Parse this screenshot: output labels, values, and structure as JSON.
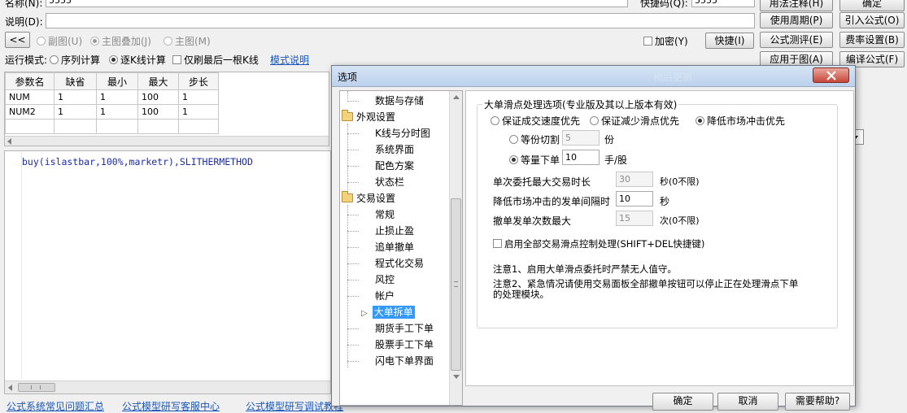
{
  "top": {
    "name_label": "名称(N):",
    "name_value": "5555",
    "shortcut_label": "快捷码(Q):",
    "shortcut_value": "5555",
    "desc_label": "说明(D):",
    "desc_value": "",
    "back_button": "<<",
    "radio_sub_chart": "副图(U)",
    "radio_main_overlay": "主图叠加(J)",
    "radio_main_chart": "主图(M)",
    "encrypt_label": "加密(Y)",
    "quick_button": "快捷(I)",
    "run_mode_label": "运行模式:",
    "run_mode_options": [
      "序列计算",
      "逐K线计算"
    ],
    "refresh_last_label": "仅刷最后一根K线",
    "mode_help_link": "模式说明"
  },
  "right_buttons": {
    "b1": "用法注释(H)",
    "b2": "确定",
    "b3": "使用周期(P)",
    "b4": "引入公式(O)",
    "b5": "公式测评(E)",
    "b6": "费率设置(B)",
    "b7": "应用于图(A)",
    "b8": "编译公式(F)"
  },
  "params": {
    "headers": [
      "参数名",
      "缺省",
      "最小",
      "最大",
      "步长"
    ],
    "rows": [
      [
        "NUM",
        "1",
        "1",
        "100",
        "1"
      ],
      [
        "NUM2",
        "1",
        "1",
        "100",
        "1"
      ]
    ]
  },
  "code": {
    "line": "buy(islastbar,100%,marketr),SLITHERMETHOD"
  },
  "bottom_links": [
    "公式系统常见问题汇总",
    "公式模型研写客服中心",
    "公式模型研写调试教程"
  ],
  "dialog": {
    "title": "选项",
    "title_ghost": "稍后更新",
    "tree": {
      "n0": "数据与存储",
      "g1": "外观设置",
      "n1": "K线与分时图",
      "n2": "系统界面",
      "n3": "配色方案",
      "n4": "状态栏",
      "g2": "交易设置",
      "n5": "常规",
      "n6": "止损止盈",
      "n7": "追单撤单",
      "n8": "程式化交易",
      "n9": "风控",
      "n10": "帐户",
      "n11": "大单拆单",
      "n12": "期货手工下单",
      "n13": "股票手工下单",
      "n14": "闪电下单界面"
    },
    "group_title": "大单滑点处理选项(专业版及其以上版本有效)",
    "opt_speed": "保证成交速度优先",
    "opt_slip": "保证减少滑点优先",
    "opt_impact": "降低市场冲击优先",
    "equal_split_label": "等份切割",
    "equal_split_value": "5",
    "equal_split_unit": "份",
    "equal_qty_label": "等量下单",
    "equal_qty_value": "10",
    "equal_qty_unit": "手/股",
    "max_time_label": "单次委托最大交易时长",
    "max_time_value": "30",
    "max_time_unit": "秒(0不限)",
    "interval_label": "降低市场冲击的发单间隔时",
    "interval_value": "10",
    "interval_unit": "秒",
    "cancel_max_label": "撤单发单次数最大",
    "cancel_max_value": "15",
    "cancel_max_unit": "次(0不限)",
    "enable_all_label": "启用全部交易滑点控制处理(SHIFT+DEL快捷键)",
    "note1": "注意1、启用大单滑点委托时严禁无人值守。",
    "note2a": "注意2、紧急情况请使用交易面板全部撤单按钮可以停止正在处理滑点下单",
    "note2b": "的处理模块。",
    "ok_button": "确定",
    "cancel_button": "取消",
    "help_button": "需要帮助?"
  }
}
